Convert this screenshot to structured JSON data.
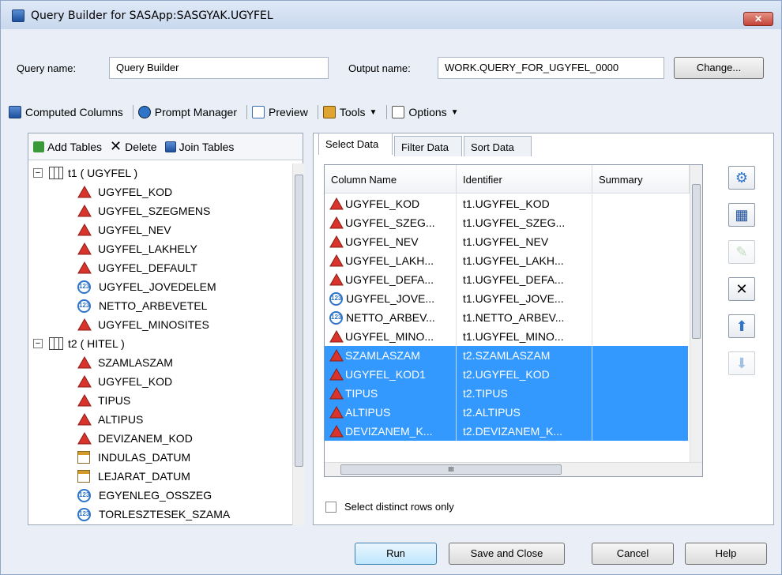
{
  "window": {
    "title": "Query Builder for SASApp:SASGYAK.UGYFEL",
    "close_label": "✕"
  },
  "header": {
    "query_name_label": "Query name:",
    "query_name_value": "Query Builder",
    "output_name_label": "Output name:",
    "output_name_value": "WORK.QUERY_FOR_UGYFEL_0000",
    "change_button": "Change..."
  },
  "toolbar": {
    "computed_columns": "Computed Columns",
    "prompt_manager": "Prompt Manager",
    "preview": "Preview",
    "tools": "Tools",
    "options": "Options"
  },
  "left": {
    "add_tables": "Add Tables",
    "delete": "Delete",
    "join_tables": "Join Tables",
    "tables": [
      {
        "label": "t1 ( UGYFEL )",
        "columns": [
          {
            "name": "UGYFEL_KOD",
            "type": "char"
          },
          {
            "name": "UGYFEL_SZEGMENS",
            "type": "char"
          },
          {
            "name": "UGYFEL_NEV",
            "type": "char"
          },
          {
            "name": "UGYFEL_LAKHELY",
            "type": "char"
          },
          {
            "name": "UGYFEL_DEFAULT",
            "type": "char"
          },
          {
            "name": "UGYFEL_JOVEDELEM",
            "type": "num"
          },
          {
            "name": "NETTO_ARBEVETEL",
            "type": "num"
          },
          {
            "name": "UGYFEL_MINOSITES",
            "type": "char"
          }
        ]
      },
      {
        "label": "t2 ( HITEL )",
        "columns": [
          {
            "name": "SZAMLASZAM",
            "type": "char"
          },
          {
            "name": "UGYFEL_KOD",
            "type": "char"
          },
          {
            "name": "TIPUS",
            "type": "char"
          },
          {
            "name": "ALTIPUS",
            "type": "char"
          },
          {
            "name": "DEVIZANEM_KOD",
            "type": "char"
          },
          {
            "name": "INDULAS_DATUM",
            "type": "date"
          },
          {
            "name": "LEJARAT_DATUM",
            "type": "date"
          },
          {
            "name": "EGYENLEG_OSSZEG",
            "type": "num"
          },
          {
            "name": "TORLESZTESEK_SZAMA",
            "type": "num"
          }
        ]
      }
    ]
  },
  "right": {
    "tabs": [
      "Select Data",
      "Filter Data",
      "Sort Data"
    ],
    "columns": [
      "Column Name",
      "Identifier",
      "Summary"
    ],
    "rows": [
      {
        "name": "UGYFEL_KOD",
        "id": "t1.UGYFEL_KOD",
        "type": "char",
        "selected": false
      },
      {
        "name": "UGYFEL_SZEG...",
        "id": "t1.UGYFEL_SZEG...",
        "type": "char",
        "selected": false
      },
      {
        "name": "UGYFEL_NEV",
        "id": "t1.UGYFEL_NEV",
        "type": "char",
        "selected": false
      },
      {
        "name": "UGYFEL_LAKH...",
        "id": "t1.UGYFEL_LAKH...",
        "type": "char",
        "selected": false
      },
      {
        "name": "UGYFEL_DEFA...",
        "id": "t1.UGYFEL_DEFA...",
        "type": "char",
        "selected": false
      },
      {
        "name": "UGYFEL_JOVE...",
        "id": "t1.UGYFEL_JOVE...",
        "type": "num",
        "selected": false
      },
      {
        "name": "NETTO_ARBEV...",
        "id": "t1.NETTO_ARBEV...",
        "type": "num",
        "selected": false
      },
      {
        "name": "UGYFEL_MINO...",
        "id": "t1.UGYFEL_MINO...",
        "type": "char",
        "selected": false
      },
      {
        "name": "SZAMLASZAM",
        "id": "t2.SZAMLASZAM",
        "type": "char",
        "selected": true
      },
      {
        "name": "UGYFEL_KOD1",
        "id": "t2.UGYFEL_KOD",
        "type": "char",
        "selected": true
      },
      {
        "name": "TIPUS",
        "id": "t2.TIPUS",
        "type": "char",
        "selected": true
      },
      {
        "name": "ALTIPUS",
        "id": "t2.ALTIPUS",
        "type": "char",
        "selected": true
      },
      {
        "name": "DEVIZANEM_K...",
        "id": "t2.DEVIZANEM_K...",
        "type": "char",
        "selected": true
      }
    ],
    "distinct_label": "Select distinct rows only",
    "hscroll_grip": "III"
  },
  "footer": {
    "run": "Run",
    "save_close": "Save and Close",
    "cancel": "Cancel",
    "help": "Help"
  },
  "colors": {
    "selection": "#3399ff",
    "char_icon": "#d9342b",
    "num_icon": "#2e74c9"
  }
}
